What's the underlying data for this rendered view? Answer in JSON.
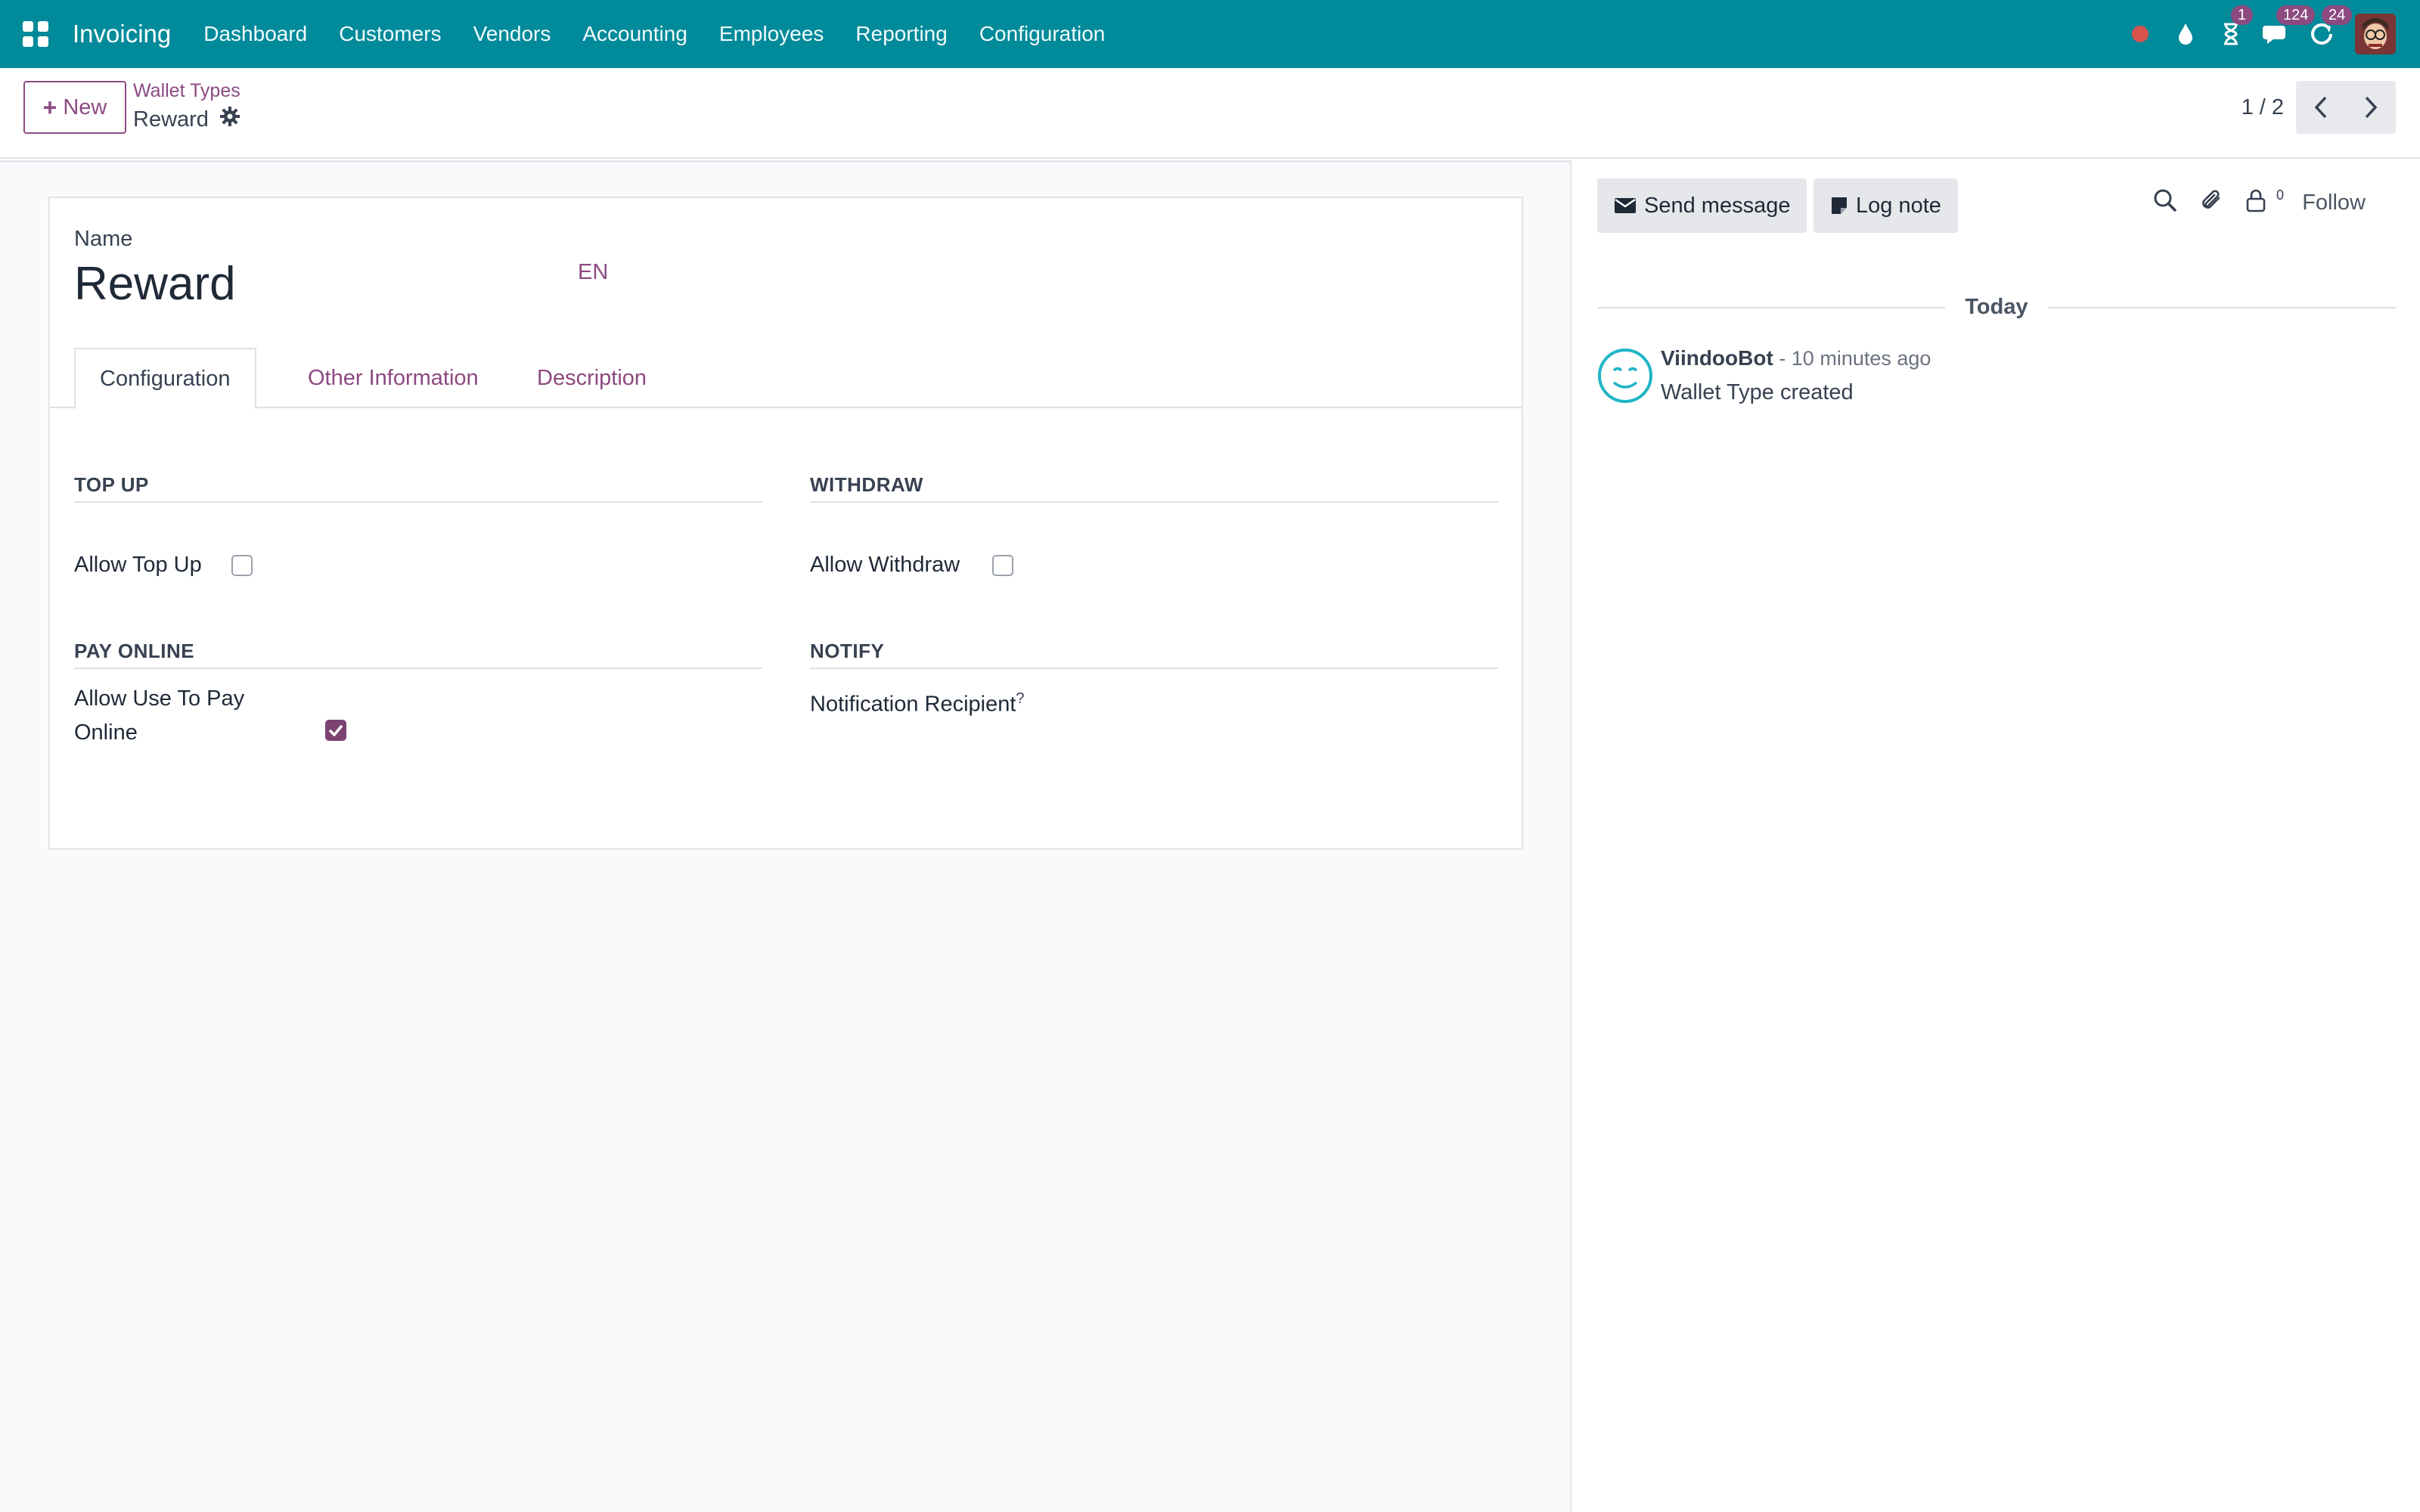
{
  "navbar": {
    "app_name": "Invoicing",
    "menu": [
      "Dashboard",
      "Customers",
      "Vendors",
      "Accounting",
      "Employees",
      "Reporting",
      "Configuration"
    ],
    "badges": {
      "activities": "1",
      "messages": "124",
      "updates": "24"
    },
    "accent_color": "#008a9a"
  },
  "control_panel": {
    "new_label": "New",
    "breadcrumb_parent": "Wallet Types",
    "breadcrumb_current": "Reward",
    "pager": "1 / 2"
  },
  "form": {
    "name_label": "Name",
    "name_value": "Reward",
    "lang": "EN",
    "tabs": [
      "Configuration",
      "Other Information",
      "Description"
    ],
    "active_tab": "Configuration",
    "groups": {
      "top_up": {
        "title": "TOP UP",
        "field_label": "Allow Top Up",
        "checked": false
      },
      "withdraw": {
        "title": "WITHDRAW",
        "field_label": "Allow Withdraw",
        "checked": false
      },
      "pay_online": {
        "title": "PAY ONLINE",
        "field_label_1": "Allow Use To Pay",
        "field_label_2": "Online",
        "checked": true
      },
      "notify": {
        "title": "NOTIFY",
        "field_label": "Notification Recipient",
        "tooltip": "?"
      }
    },
    "brand_color": "#8c4a81"
  },
  "chatter": {
    "send_message": "Send message",
    "log_note": "Log note",
    "follower_count": "0",
    "follow": "Follow",
    "separator": "Today",
    "messages": [
      {
        "author": "ViindooBot",
        "time": " - 10 minutes ago",
        "body": "Wallet Type created"
      }
    ]
  }
}
